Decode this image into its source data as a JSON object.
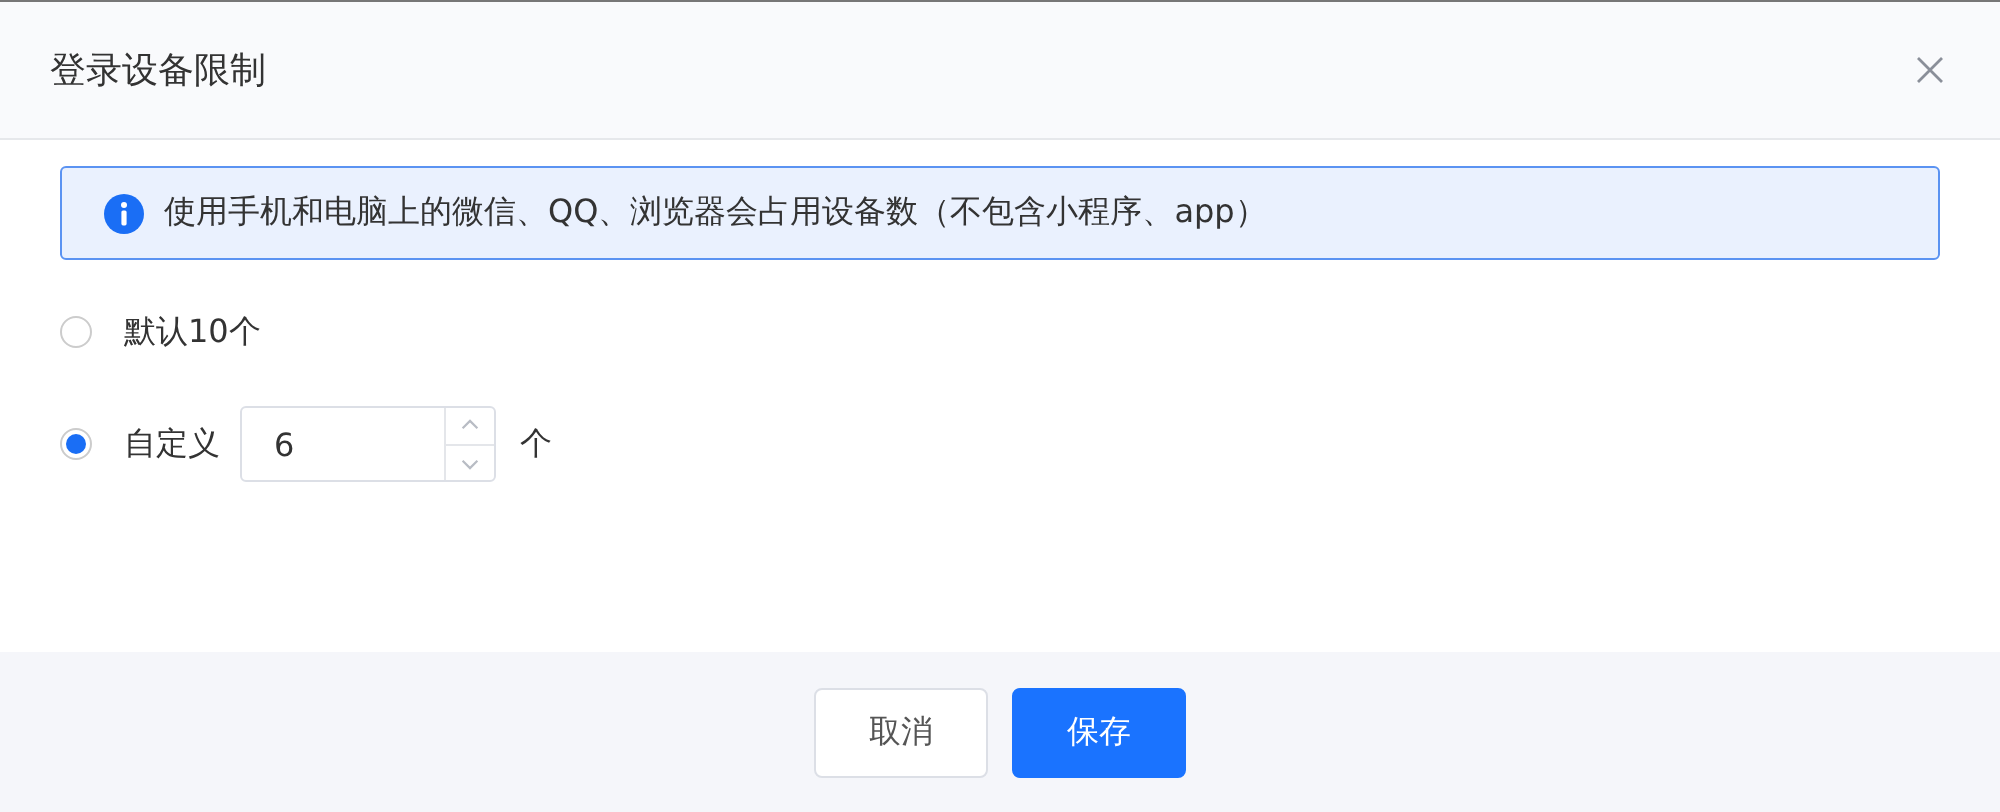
{
  "dialog": {
    "title": "登录设备限制"
  },
  "notice": {
    "text": "使用手机和电脑上的微信、QQ、浏览器会占用设备数（不包含小程序、app）"
  },
  "options": [
    {
      "kind": "plain",
      "label": "默认10个",
      "selected": false
    },
    {
      "kind": "number",
      "label": "自定义",
      "selected": true,
      "value": "6",
      "unit": "个"
    }
  ],
  "buttons": [
    {
      "kind": "secondary",
      "label": "取消"
    },
    {
      "kind": "primary",
      "label": "保存"
    }
  ]
}
